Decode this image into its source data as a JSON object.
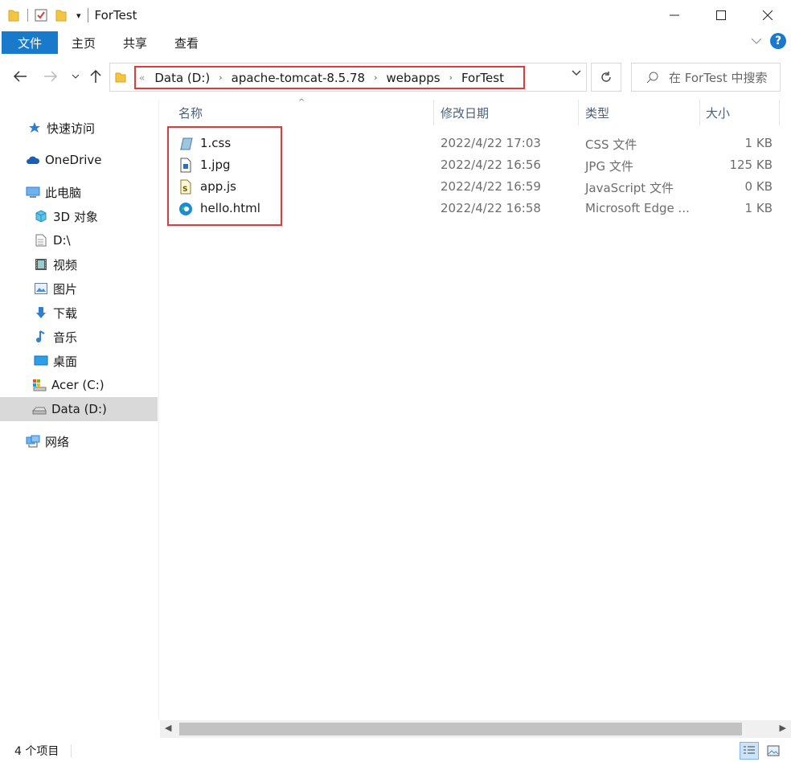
{
  "window": {
    "title": "ForTest"
  },
  "ribbon": {
    "tabs": [
      "文件",
      "主页",
      "共享",
      "查看"
    ]
  },
  "address": {
    "breadcrumbs": [
      "Data (D:)",
      "apache-tomcat-8.5.78",
      "webapps",
      "ForTest"
    ],
    "search_placeholder": "在 ForTest 中搜索"
  },
  "nav": {
    "items": [
      {
        "label": "快速访问",
        "icon": "star-icon"
      },
      {
        "label": "OneDrive",
        "icon": "cloud-icon"
      },
      {
        "label": "此电脑",
        "icon": "computer-icon"
      },
      {
        "label": "3D 对象",
        "icon": "cube-icon"
      },
      {
        "label": "D:\\",
        "icon": "document-icon"
      },
      {
        "label": "视频",
        "icon": "film-icon"
      },
      {
        "label": "图片",
        "icon": "picture-icon"
      },
      {
        "label": "下载",
        "icon": "download-icon"
      },
      {
        "label": "音乐",
        "icon": "music-icon"
      },
      {
        "label": "桌面",
        "icon": "desktop-icon"
      },
      {
        "label": "Acer (C:)",
        "icon": "drive-icon"
      },
      {
        "label": "Data (D:)",
        "icon": "drive-icon",
        "selected": true
      },
      {
        "label": "网络",
        "icon": "network-icon"
      }
    ]
  },
  "columns": {
    "name": "名称",
    "date": "修改日期",
    "type": "类型",
    "size": "大小"
  },
  "files": [
    {
      "name": "1.css",
      "date": "2022/4/22 17:03",
      "type": "CSS 文件",
      "size": "1 KB",
      "icon": "css-file-icon"
    },
    {
      "name": "1.jpg",
      "date": "2022/4/22 16:56",
      "type": "JPG 文件",
      "size": "125 KB",
      "icon": "image-file-icon"
    },
    {
      "name": "app.js",
      "date": "2022/4/22 16:59",
      "type": "JavaScript 文件",
      "size": "0 KB",
      "icon": "js-file-icon"
    },
    {
      "name": "hello.html",
      "date": "2022/4/22 16:58",
      "type": "Microsoft Edge ...",
      "size": "1 KB",
      "icon": "edge-icon"
    }
  ],
  "status": {
    "item_count": "4 个项目"
  },
  "colors": {
    "accent": "#1979ca",
    "highlight_box": "#e03b3b",
    "selected_nav": "#d9d9d9"
  }
}
